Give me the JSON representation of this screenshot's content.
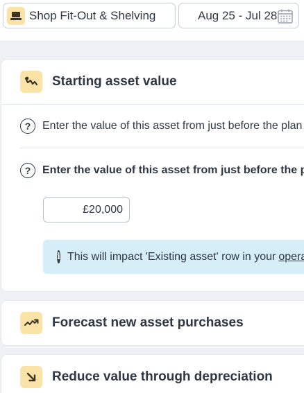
{
  "header": {
    "asset_name": "Shop Fit-Out & Shelving",
    "asset_icon": "laptop-icon",
    "date_range": "Aug 25 - Jul 28",
    "date_icon": "calendar-icon"
  },
  "starting_asset": {
    "title": "Starting asset value",
    "icon": "chart-squiggle-icon",
    "question_1": "Enter the value of this asset from just before the plan",
    "question_2": "Enter the value of this asset from just before the plan",
    "value": "£20,000",
    "info_text": "This will impact 'Existing asset' row in your",
    "info_link": "operating plan"
  },
  "forecast": {
    "title": "Forecast new asset purchases",
    "icon": "trend-up-icon"
  },
  "depreciation": {
    "title": "Reduce value through depreciation",
    "icon": "arrow-down-right-icon"
  },
  "colors": {
    "icon_bg": "#fbe3a8",
    "info_bg": "#d6eef7",
    "page_bg": "#eef2f6",
    "text": "#2f3743"
  }
}
